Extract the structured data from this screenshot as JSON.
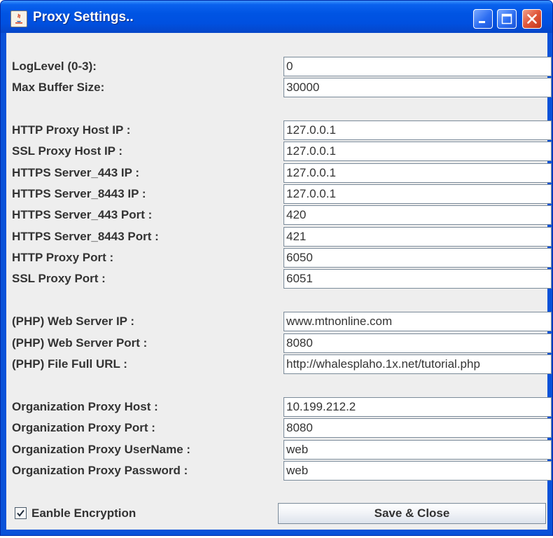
{
  "window": {
    "title": "Proxy Settings.."
  },
  "fields": [
    {
      "label": "LogLevel (0-3):",
      "value": "0"
    },
    {
      "label": "Max Buffer Size:",
      "value": "30000"
    },
    {
      "label": "HTTP Proxy Host IP :",
      "value": "127.0.0.1"
    },
    {
      "label": "SSL Proxy Host IP :",
      "value": "127.0.0.1"
    },
    {
      "label": "HTTPS Server_443 IP :",
      "value": "127.0.0.1"
    },
    {
      "label": "HTTPS Server_8443 IP :",
      "value": "127.0.0.1"
    },
    {
      "label": "HTTPS Server_443 Port :",
      "value": "420"
    },
    {
      "label": "HTTPS Server_8443 Port :",
      "value": "421"
    },
    {
      "label": "HTTP Proxy Port :",
      "value": "6050"
    },
    {
      "label": "SSL Proxy Port :",
      "value": "6051"
    },
    {
      "label": "(PHP) Web Server IP :",
      "value": "www.mtnonline.com"
    },
    {
      "label": "(PHP) Web Server Port :",
      "value": "8080"
    },
    {
      "label": "(PHP) File Full URL :",
      "value": "http://whalesplaho.1x.net/tutorial.php"
    },
    {
      "label": "Organization Proxy Host :",
      "value": "10.199.212.2"
    },
    {
      "label": "Organization Proxy Port :",
      "value": "8080"
    },
    {
      "label": "Organization Proxy UserName :",
      "value": "web"
    },
    {
      "label": "Organization Proxy Password :",
      "value": "web"
    }
  ],
  "encryption": {
    "label": "Eanble Encryption",
    "checked": true
  },
  "save_button": {
    "label": "Save & Close"
  },
  "icons": {
    "app": "java-app-icon",
    "minimize": "minimize-icon",
    "maximize": "maximize-icon",
    "close": "close-icon",
    "check": "checkmark-icon"
  },
  "colors": {
    "titlebar": "#0054e3",
    "client_background": "#eeeeee",
    "close_button": "#e0553a"
  }
}
